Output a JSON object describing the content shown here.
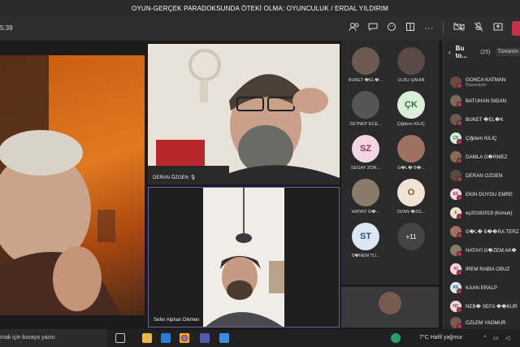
{
  "window": {
    "title": "OYUN-GERÇEK PARADOKSUNDA ÖTEKİ OLMA: OYUNCULUK / ERDAL YILDIRIM"
  },
  "toolbar": {
    "timer": "5:39",
    "icons": [
      "people-icon",
      "chat-icon",
      "reactions-icon",
      "rooms-icon",
      "more-icon",
      "camera-off-icon",
      "mic-off-icon",
      "share-icon",
      "leave-icon"
    ]
  },
  "stage": {
    "tiles": [
      {
        "name": "",
        "mic": ""
      },
      {
        "name": "DERAN ÖZGEN",
        "mic": "🎙"
      },
      {
        "name": "Sefer Alphan Dikmen",
        "mic": ""
      }
    ]
  },
  "gallery": {
    "items": [
      {
        "initials": "",
        "name": "BUKET �EL�...",
        "bg": "#6b5a50"
      },
      {
        "initials": "",
        "name": "ÜLKÜ ŞAHİN",
        "bg": "#5a4a45"
      },
      {
        "initials": "",
        "name": "ZEYNEP ECE...",
        "bg": "#555"
      },
      {
        "initials": "ÇK",
        "name": "Çiğdem KILIÇ",
        "bg": "#d9efd9",
        "fg": "#3a6b3a"
      },
      {
        "initials": "SZ",
        "name": "SEGAY ZOR...",
        "bg": "#f3d6e2",
        "fg": "#8a3a5a"
      },
      {
        "initials": "",
        "name": "G�L� B�...",
        "bg": "#a07060"
      },
      {
        "initials": "",
        "name": "HATAYİ G�...",
        "bg": "#8a7a6a"
      },
      {
        "initials": "O",
        "name": "OZAN �ZG...",
        "bg": "#f1e3d3",
        "fg": "#7a5a30"
      },
      {
        "initials": "ST",
        "name": "S�NEM TU...",
        "bg": "#dde6f3",
        "fg": "#2f4f7a"
      },
      {
        "initials": "+11",
        "name": "",
        "bg": "#444",
        "fg": "#fff"
      }
    ]
  },
  "panel": {
    "title": "Bu to...",
    "count": "(25)",
    "button": "Tümünün",
    "participants": [
      {
        "name": "GONCA KATMAN",
        "sub": "Düzenleyici",
        "initials": "",
        "bg": "#6a4a40"
      },
      {
        "name": "BATUHAN SIĞAN",
        "sub": "",
        "initials": "",
        "bg": "#7a6a5a"
      },
      {
        "name": "BUKET �EL�K",
        "sub": "",
        "initials": "",
        "bg": "#6b5a50"
      },
      {
        "name": "Çiğdem KILIÇ",
        "sub": "",
        "initials": "ÇK",
        "bg": "#d9efd9"
      },
      {
        "name": "DAMLA G�RMEZ",
        "sub": "",
        "initials": "",
        "bg": "#8a6a5a"
      },
      {
        "name": "DERAN ÖZGEN",
        "sub": "",
        "initials": "",
        "bg": "#5a4a40"
      },
      {
        "name": "EKİN DUYGU EMRE",
        "sub": "",
        "initials": "EE",
        "bg": "#f3d6e2"
      },
      {
        "name": "ey20162019 (Konuk)",
        "sub": "",
        "initials": "E",
        "bg": "#f1e3d3"
      },
      {
        "name": "G�L� B��RA TERZ",
        "sub": "",
        "initials": "",
        "bg": "#a07060"
      },
      {
        "name": "HATAYİ G�ZEM AK�",
        "sub": "",
        "initials": "",
        "bg": "#8a7a6a"
      },
      {
        "name": "İREM RABİA OBUZ",
        "sub": "",
        "initials": "IO",
        "bg": "#f3d6e2"
      },
      {
        "name": "KAAN ERALP",
        "sub": "",
        "initials": "KE",
        "bg": "#dde6f3"
      },
      {
        "name": "NEB� SEFA ��KUR",
        "sub": "",
        "initials": "NÇ",
        "bg": "#f3d6e2"
      },
      {
        "name": "ÖZLEM YAĞMUR",
        "sub": "",
        "initials": "",
        "bg": "#7a5a50"
      }
    ]
  },
  "taskbar": {
    "search_placeholder": "mak için buraya yazın",
    "weather": "7°C  Hafif yağmur",
    "tray_icons": [
      "network-icon",
      "volume-icon",
      "notification-icon"
    ]
  },
  "colors": {
    "accent": "#6264a7",
    "leave": "#c4314b",
    "background": "#1f1f1f"
  }
}
